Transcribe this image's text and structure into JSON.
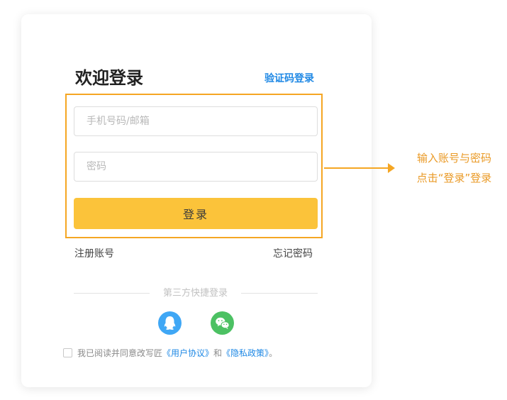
{
  "login": {
    "title": "欢迎登录",
    "code_login_link": "验证码登录",
    "phone_placeholder": "手机号码/邮箱",
    "password_placeholder": "密码",
    "submit_label": "登录",
    "register_link": "注册账号",
    "forgot_link": "忘记密码",
    "third_party_label": "第三方快捷登录",
    "social_icons": [
      "qq-icon",
      "wechat-icon"
    ]
  },
  "agreement": {
    "checked": false,
    "prefix": "我已阅读并同意改写匠",
    "user_agreement": "《用户协议》",
    "conjunction": "和",
    "privacy_policy": "《隐私政策》",
    "suffix": "。"
  },
  "annotation": {
    "line1": "输入账号与密码",
    "line2": "点击“登录”登录",
    "color": "#f5a623"
  },
  "colors": {
    "accent_button": "#fbc33a",
    "link": "#1e88e5",
    "qq": "#3fa7f5",
    "wechat": "#4cc163"
  }
}
